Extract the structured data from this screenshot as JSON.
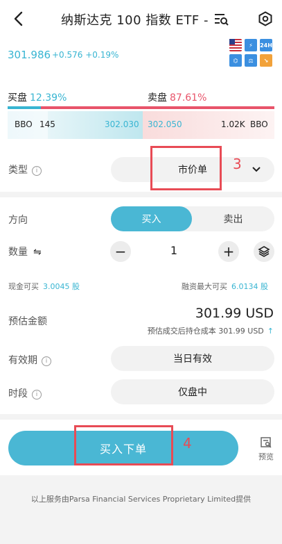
{
  "header": {
    "title": "纳斯达克 100 指数 ETF -",
    "back_icon": "back-arrow-icon",
    "search_icon": "list-search-icon",
    "settings_icon": "settings-hex-icon"
  },
  "quote": {
    "price": "301.986",
    "change": "+0.576 +0.19%",
    "badges": [
      "US",
      "⚡",
      "24H",
      "⌬",
      "⚖",
      "↘"
    ]
  },
  "orderbook": {
    "buy_label": "买盘",
    "buy_pct": "12.39%",
    "sell_label": "卖盘",
    "sell_pct": "87.61%",
    "buy_ratio": 0.1239,
    "bbo_left_tag": "BBO",
    "bid_size": "145",
    "bid_price": "302.030",
    "ask_price": "302.050",
    "ask_size": "1.02K",
    "bbo_right_tag": "BBO"
  },
  "form": {
    "type_label": "类型",
    "type_value": "市价单",
    "direction_label": "方向",
    "buy": "买入",
    "sell": "卖出",
    "quantity_label": "数量",
    "quantity_swap": "⇋",
    "quantity_value": "1",
    "cash_label": "现金可买",
    "cash_value": "3.0045 股",
    "margin_label": "融资最大可买",
    "margin_value": "6.0134 股",
    "est_label": "预估金额",
    "est_value": "301.99 USD",
    "est_sub": "预估成交后持仓成本 301.99 USD",
    "validity_label": "有效期",
    "validity_value": "当日有效",
    "session_label": "时段",
    "session_value": "仅盘中"
  },
  "actions": {
    "submit": "买入下单",
    "preview": "预览"
  },
  "annotations": {
    "step3": "3",
    "step4": "4"
  },
  "footer": {
    "text": "以上服务由Parsa Financial Services Proprietary Limited提供"
  },
  "colors": {
    "accent": "#4ab7d4",
    "sell": "#e8546a",
    "annotation": "#e84b55"
  }
}
